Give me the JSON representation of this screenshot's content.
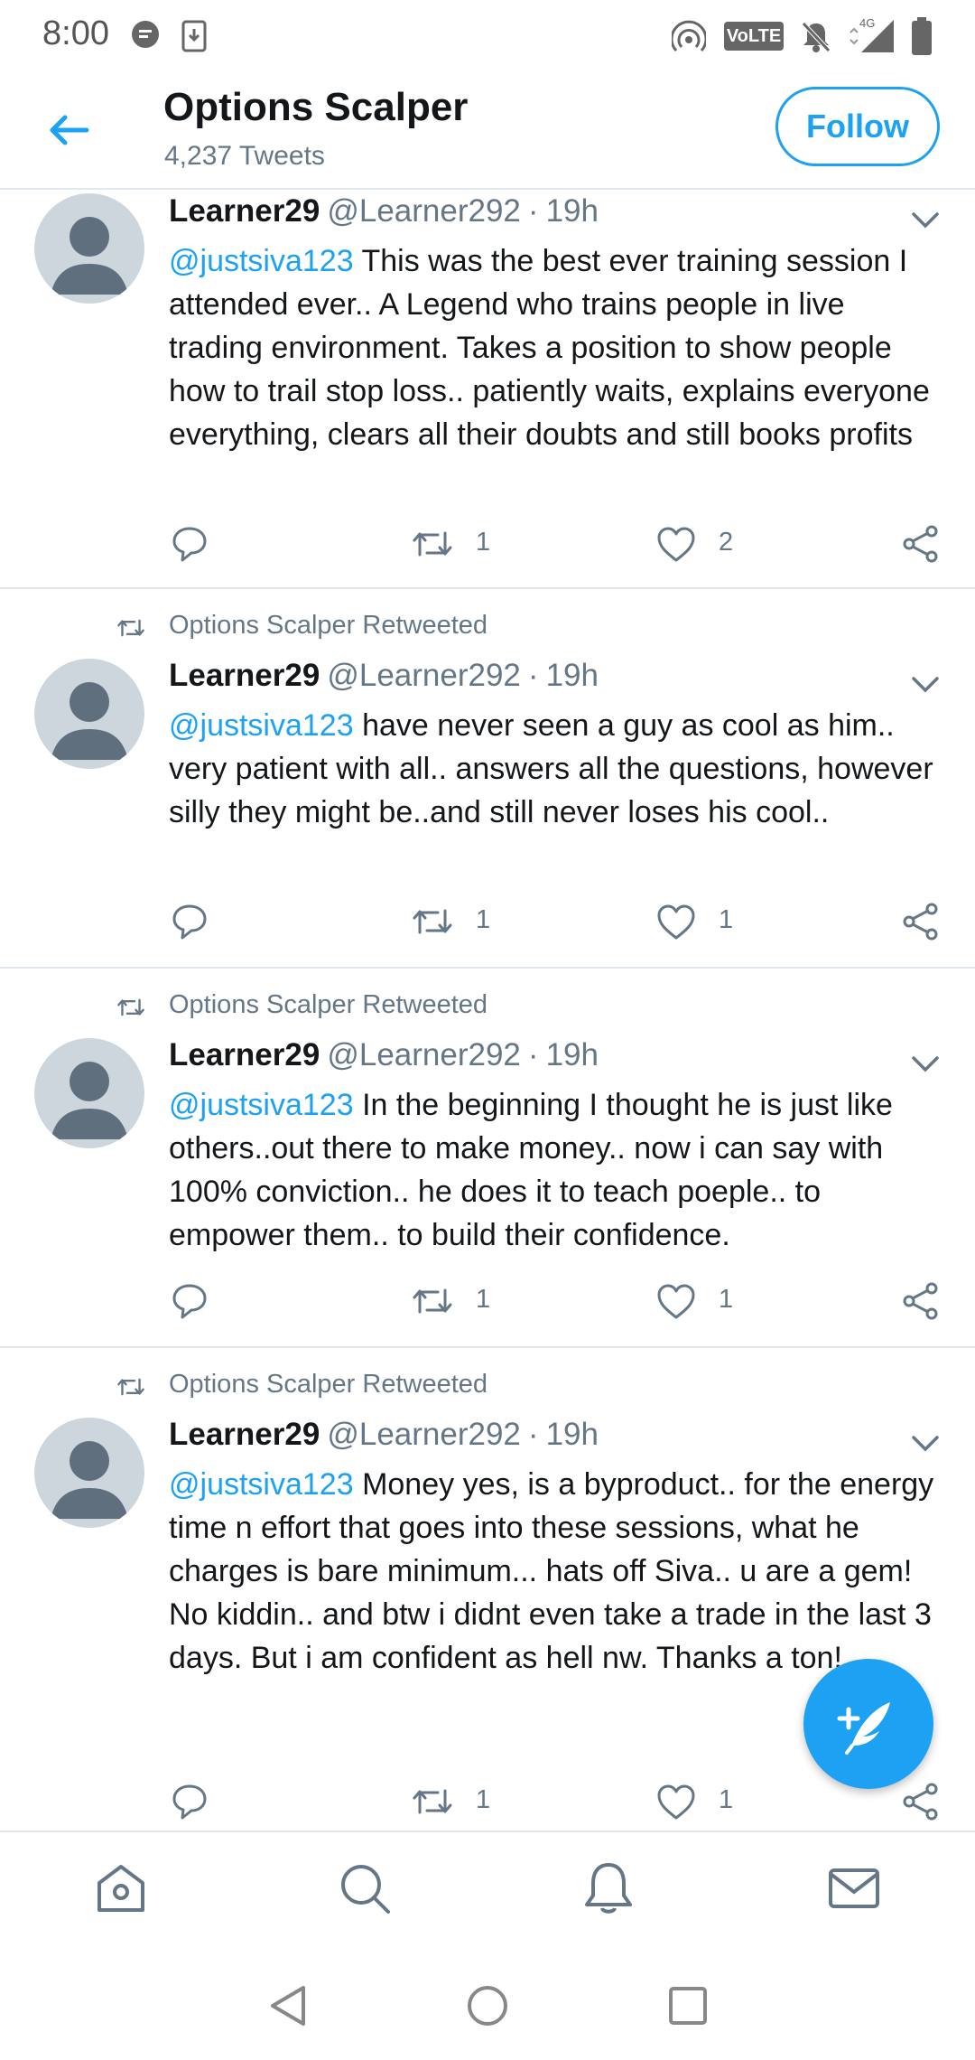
{
  "status_bar": {
    "time": "8:00",
    "icons": [
      "message-notification-icon",
      "download-icon",
      "hotspot-icon",
      "volte-icon",
      "notifications-off-icon",
      "signal-4g-icon",
      "battery-icon"
    ],
    "volte_label": "VoLTE",
    "network_label": "4G"
  },
  "header": {
    "title": "Options Scalper",
    "subtitle": "4,237 Tweets",
    "follow_label": "Follow",
    "accent_color": "#1da1f2"
  },
  "tweets": [
    {
      "retweet_label": "",
      "name": "Learner29",
      "handle": "@Learner292",
      "separator": "·",
      "time": "19h",
      "mention": "@justsiva123",
      "text": " This was the best ever training session I attended ever.. A Legend who trains people in live trading environment. Takes a position to show people how to trail stop loss..  patiently waits, explains everyone everything, clears all their doubts and still books profits",
      "retweets": "1",
      "likes": "2"
    },
    {
      "retweet_label": "Options Scalper Retweeted",
      "name": "Learner29",
      "handle": "@Learner292",
      "separator": "·",
      "time": "19h",
      "mention": "@justsiva123",
      "text": "  have never seen a guy as cool as him.. very patient with all.. answers all the questions, however silly they might be..and still  never loses his cool..",
      "retweets": "1",
      "likes": "1"
    },
    {
      "retweet_label": "Options Scalper Retweeted",
      "name": "Learner29",
      "handle": "@Learner292",
      "separator": "·",
      "time": "19h",
      "mention": "@justsiva123",
      "text": "  In the beginning I thought he is just like others..out there to make money.. now i can say with 100% conviction.. he does it to teach poeple.. to empower them.. to build their confidence.",
      "retweets": "1",
      "likes": "1"
    },
    {
      "retweet_label": "Options Scalper Retweeted",
      "name": "Learner29",
      "handle": "@Learner292",
      "separator": "·",
      "time": "19h",
      "mention": "@justsiva123",
      "text": " Money yes, is a byproduct.. for the energy time n effort that goes into these sessions, what he charges is bare minimum... hats off Siva.. u are a gem! No kiddin.. and btw i didnt even take a trade in the last 3 days. But i am confident as hell nw. Thanks a ton!",
      "retweets": "1",
      "likes": "1"
    }
  ],
  "bottom_nav": [
    "home-icon",
    "search-icon",
    "notifications-icon",
    "messages-icon"
  ],
  "system_nav": [
    "back-icon",
    "home-circle-icon",
    "recents-icon"
  ]
}
